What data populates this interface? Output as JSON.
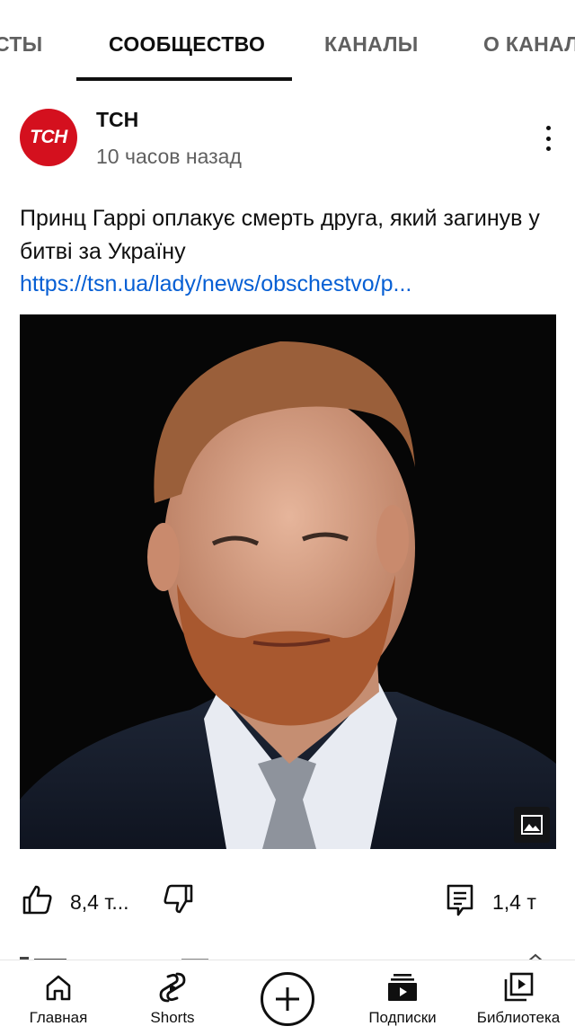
{
  "tabs": {
    "items": [
      "СТЫ",
      "СООБЩЕСТВО",
      "КАНАЛЫ",
      "О КАНАЛЕ"
    ],
    "active": "СООБЩЕСТВО"
  },
  "post": {
    "channel_name": "ТСН",
    "avatar_text": "ТСН",
    "avatar_color": "#d4101e",
    "time": "10 часов назад",
    "text": "Принц Гаррі оплакує смерть друга, який загинув у битві за Україну",
    "link": "https://tsn.ua/lady/news/obschestvo/p...",
    "link_color": "#065fd4",
    "image_icon": "image-icon"
  },
  "actions": {
    "likes": "8,4 т...",
    "comments": "1,4 т",
    "like_icon": "thumb-up-icon",
    "dislike_icon": "thumb-down-icon",
    "comment_icon": "comment-icon"
  },
  "bottom_nav": {
    "home": "Главная",
    "shorts": "Shorts",
    "create_icon": "plus-icon",
    "subscriptions": "Подписки",
    "library": "Библиотека"
  }
}
